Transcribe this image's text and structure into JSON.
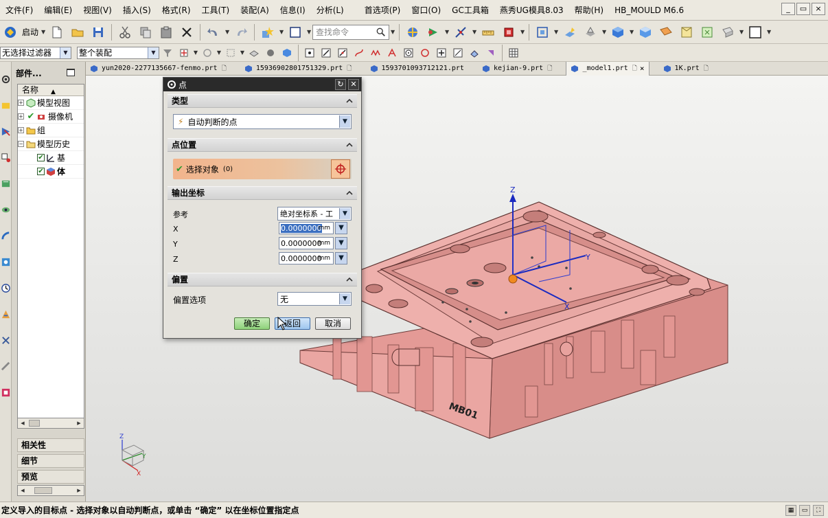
{
  "menu": [
    "文件(F)",
    "编辑(E)",
    "视图(V)",
    "插入(S)",
    "格式(R)",
    "工具(T)",
    "装配(A)",
    "信息(I)",
    "分析(L)",
    "首选项(P)",
    "窗口(O)",
    "GC工具箱",
    "燕秀UG模具8.03",
    "帮助(H)",
    "HB_MOULD M6.6"
  ],
  "toolbar": {
    "start_label": "启动",
    "search_placeholder": "查找命令"
  },
  "toolbar2": {
    "filter": "无选择过滤器",
    "scope": "整个装配"
  },
  "navigator": {
    "title": "部件...",
    "column": "名称",
    "items": [
      "模型视图",
      "摄像机",
      "组",
      "模型历史",
      "基",
      "体"
    ],
    "sections": [
      "相关性",
      "细节",
      "预览"
    ]
  },
  "tabs": [
    {
      "label": "yun2020-2277135667-fenmo.prt",
      "active": false
    },
    {
      "label": "15936902801751329.prt",
      "active": false
    },
    {
      "label": "1593701093712121.prt",
      "active": false
    },
    {
      "label": "kejian-9.prt",
      "active": false
    },
    {
      "label": "_model1.prt",
      "active": true
    },
    {
      "label": "1K.prt",
      "active": false
    }
  ],
  "dialog": {
    "title": "点",
    "type_section": "类型",
    "type_value": "自动判断的点",
    "location_section": "点位置",
    "select_label": "选择对象",
    "select_count": "(0)",
    "output_section": "输出坐标",
    "reference_label": "参考",
    "reference_value": "绝对坐标系 - 工",
    "x_label": "X",
    "y_label": "Y",
    "z_label": "Z",
    "x_value": "0.0000000",
    "y_value": "0.0000000",
    "z_value": "0.0000000",
    "unit": "mm",
    "offset_section": "偏置",
    "offset_label": "偏置选项",
    "offset_value": "无",
    "ok": "确定",
    "back": "返回",
    "cancel": "取消"
  },
  "viewport": {
    "part_label": "MB01",
    "axis_x": "X",
    "axis_y": "Y",
    "axis_z": "Z",
    "model_color": "#e8a8a4"
  },
  "status": "定义导入的目标点 - 选择对象以自动判断点，或单击 “确定” 以在坐标位置指定点"
}
